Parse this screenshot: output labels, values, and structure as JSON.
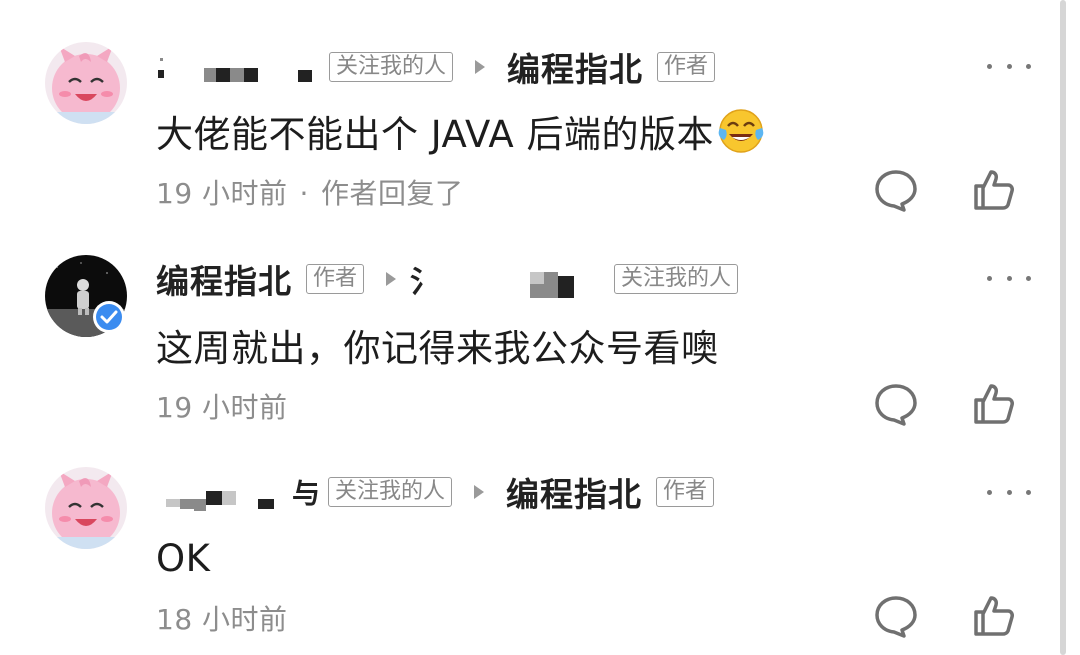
{
  "colors": {
    "tag_border": "#9a9a9a",
    "text": "#1d1d1d",
    "meta": "#8d8d8d",
    "verified": "#3b8cf0"
  },
  "comments": [
    {
      "author_label": "关注我的人",
      "reply_to": "编程指北",
      "reply_to_label": "作者",
      "text": "大佬能不能出个 JAVA 后端的版本",
      "emoji": "laughing-crying-emoji",
      "time": "19 小时前",
      "extra": "作者回复了"
    },
    {
      "author": "编程指北",
      "author_label": "作者",
      "reply_to_label": "关注我的人",
      "reply_to_partial": "氵",
      "text": "这周就出，你记得来我公众号看噢",
      "time": "19 小时前"
    },
    {
      "author_partial": "与",
      "author_label": "关注我的人",
      "reply_to": "编程指北",
      "reply_to_label": "作者",
      "text": "OK",
      "time": "18 小时前"
    }
  ]
}
